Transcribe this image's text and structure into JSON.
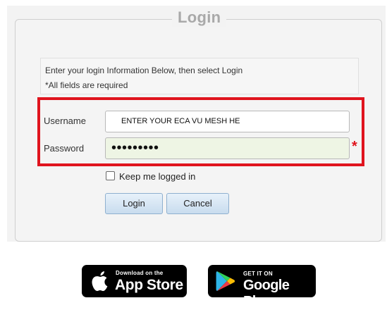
{
  "login_box": {
    "title": "Login",
    "instructions": "Enter your login Information Below, then select Login",
    "required_note": "*All fields are required"
  },
  "form": {
    "username_label": "Username",
    "username_value": "ENTER YOUR ECA VU MESH HE",
    "password_label": "Password",
    "password_value": "•••••••••",
    "required_marker": "*",
    "keep_logged_in_label": "Keep me logged in",
    "keep_logged_in_checked": false
  },
  "buttons": {
    "login_label": "Login",
    "cancel_label": "Cancel"
  },
  "stores": {
    "app_store_small": "Download on the",
    "app_store_big": "App Store",
    "google_play_small": "GET IT ON",
    "google_play_big": "Google Play"
  },
  "colors": {
    "highlight_border": "#e0141e",
    "password_field_bg": "#eef5e4",
    "button_bg": "#c8dcee"
  },
  "icons": [
    "apple-icon",
    "google-play-icon",
    "checkbox"
  ]
}
